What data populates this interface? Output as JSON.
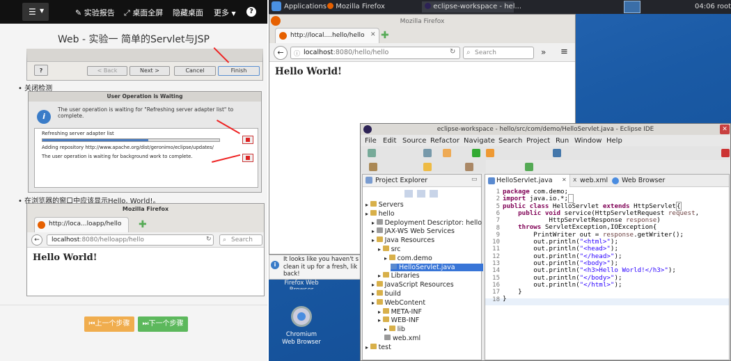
{
  "left_page": {
    "topbar": {
      "report": "实验报告",
      "fullscreen": "桌面全屏",
      "hide": "隐藏桌面",
      "more": "更多",
      "help": "?"
    },
    "title": "Web - 实验一 简单的Servlet与JSP",
    "wizard": {
      "help": "?",
      "back": "< Back",
      "next": "Next >",
      "cancel": "Cancel",
      "finish": "Finish"
    },
    "bullet1": "关闭检测",
    "dialog": {
      "title": "User Operation is Waiting",
      "message": "The user operation is waiting for \"Refreshing server adapter list\" to complete.",
      "task1": "Refreshing server adapter list",
      "task1_detail": "Adding repository http://www.apache.org/dist/geronimo/eclipse/updates/",
      "task2": "The user operation is waiting for background work to complete."
    },
    "bullet2": "在浏览器的窗口中应该显示Hello, World!。",
    "ff": {
      "window_title": "Mozilla Firefox",
      "tab": "http://loca...loapp/hello",
      "url_host": "localhost",
      "url_rest": ":8080/helloapp/hello",
      "search": "Search",
      "content": "Hello World!"
    },
    "prev_btn": "上一个步骤",
    "next_btn": "下一个步骤"
  },
  "panel": {
    "apps": "Applications",
    "firefox": "Mozilla Firefox",
    "eclipse": "eclipse-workspace - hel...",
    "time": "04:06",
    "user": "root"
  },
  "firefox": {
    "window_title": "Mozilla Firefox",
    "tab": "http://local....hello/hello",
    "url_host": "localhost",
    "url_rest": ":8080/hello/hello",
    "search": "Search",
    "content": "Hello World!"
  },
  "notification": "It looks like you haven't s clean it up for a fresh, lik back!",
  "desktop_icons": {
    "firefox": "Firefox Web Browser",
    "chromium_1": "Chromium",
    "chromium_2": "Web Browser"
  },
  "eclipse": {
    "title": "eclipse-workspace - hello/src/com/demo/HelloServlet.java - Eclipse IDE",
    "menu": [
      "File",
      "Edit",
      "Source",
      "Refactor",
      "Navigate",
      "Search",
      "Project",
      "Run",
      "Window",
      "Help"
    ],
    "explorer_title": "Project Explorer",
    "tree": [
      {
        "label": "Servers",
        "indent": 0,
        "sel": false
      },
      {
        "label": "hello",
        "indent": 0,
        "sel": false
      },
      {
        "label": "Deployment Descriptor: hello",
        "indent": 1,
        "sel": false
      },
      {
        "label": "JAX-WS Web Services",
        "indent": 1,
        "sel": false
      },
      {
        "label": "Java Resources",
        "indent": 1,
        "sel": false
      },
      {
        "label": "src",
        "indent": 2,
        "sel": false
      },
      {
        "label": "com.demo",
        "indent": 3,
        "sel": false
      },
      {
        "label": "HelloServlet.java",
        "indent": 4,
        "sel": true
      },
      {
        "label": "Libraries",
        "indent": 2,
        "sel": false
      },
      {
        "label": "JavaScript Resources",
        "indent": 1,
        "sel": false
      },
      {
        "label": "build",
        "indent": 1,
        "sel": false
      },
      {
        "label": "WebContent",
        "indent": 1,
        "sel": false
      },
      {
        "label": "META-INF",
        "indent": 2,
        "sel": false
      },
      {
        "label": "WEB-INF",
        "indent": 2,
        "sel": false
      },
      {
        "label": "lib",
        "indent": 3,
        "sel": false
      },
      {
        "label": "web.xml",
        "indent": 3,
        "sel": false
      },
      {
        "label": "test",
        "indent": 0,
        "sel": false
      }
    ],
    "tabs": [
      "HelloServlet.java",
      "web.xml",
      "Web Browser"
    ],
    "line_numbers": [
      "1",
      "2",
      "5",
      "6",
      "7",
      "8",
      "9",
      "10",
      "11",
      "12",
      "13",
      "14",
      "15",
      "16",
      "17",
      "18"
    ]
  }
}
